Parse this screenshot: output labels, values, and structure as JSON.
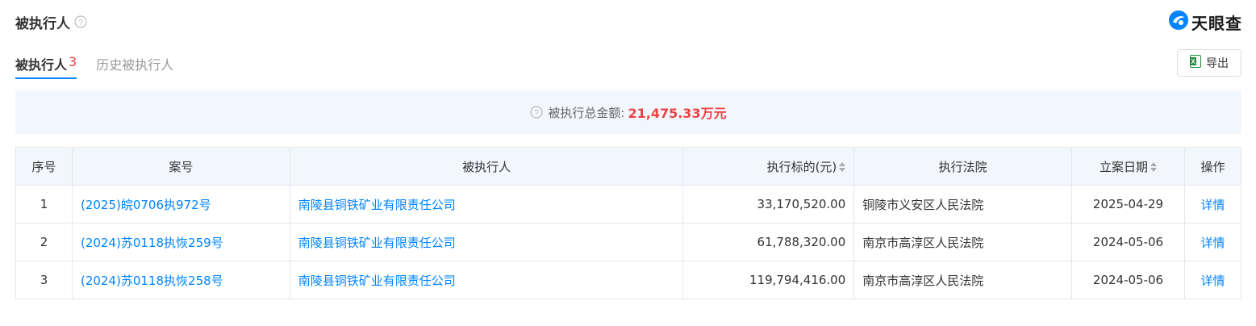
{
  "header": {
    "title": "被执行人",
    "logo_text": "天眼查"
  },
  "tabs": [
    {
      "label": "被执行人",
      "count": "3",
      "active": true
    },
    {
      "label": "历史被执行人",
      "count": "",
      "active": false
    }
  ],
  "toolbar": {
    "export_label": "导出"
  },
  "summary": {
    "label": "被执行总金额:",
    "amount": "21,475.33万元"
  },
  "table": {
    "columns": [
      "序号",
      "案号",
      "被执行人",
      "执行标的(元)",
      "执行法院",
      "立案日期",
      "操作"
    ],
    "rows": [
      {
        "idx": "1",
        "case_no": "(2025)皖0706执972号",
        "party": "南陵县铜铁矿业有限责任公司",
        "amount": "33,170,520.00",
        "court": "铜陵市义安区人民法院",
        "date": "2025-04-29",
        "action": "详情"
      },
      {
        "idx": "2",
        "case_no": "(2024)苏0118执恢259号",
        "party": "南陵县铜铁矿业有限责任公司",
        "amount": "61,788,320.00",
        "court": "南京市高淳区人民法院",
        "date": "2024-05-06",
        "action": "详情"
      },
      {
        "idx": "3",
        "case_no": "(2024)苏0118执恢258号",
        "party": "南陵县铜铁矿业有限责任公司",
        "amount": "119,794,416.00",
        "court": "南京市高淳区人民法院",
        "date": "2024-05-06",
        "action": "详情"
      }
    ]
  },
  "colors": {
    "accent": "#0084ff",
    "amount_red": "#f04142",
    "summary_bg": "#f2f7fd"
  },
  "icons": {
    "help": "question-circle-icon",
    "logo": "tianyancha-logo-icon",
    "export": "excel-icon",
    "sort": "sort-icon"
  }
}
